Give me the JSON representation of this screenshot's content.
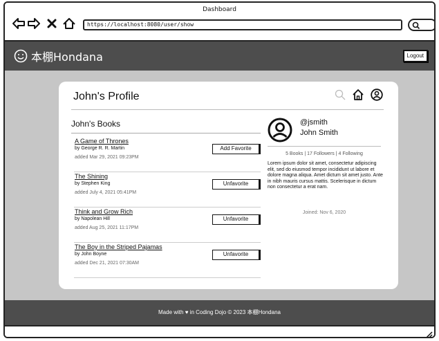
{
  "window": {
    "title": "Dashboard"
  },
  "browser": {
    "url": "https://localhost:8080/user/show",
    "icons": [
      "back-arrow-icon",
      "forward-arrow-icon",
      "close-x-icon",
      "home-icon",
      "search-icon"
    ]
  },
  "navbar": {
    "brand": "本棚Hondana",
    "logo_icon": "smiley-icon",
    "logout_label": "Logout"
  },
  "profile": {
    "title": "John's Profile",
    "icons": [
      "search-icon",
      "home-icon",
      "user-circle-icon"
    ]
  },
  "books": {
    "heading": "John's Books",
    "items": [
      {
        "title": "A Game of Thrones",
        "author": "by George R. R. Martin",
        "added": "added Mar 29, 2021 09:23PM",
        "action": "Add Favorite"
      },
      {
        "title": "The Shining",
        "author": "by Stephen King",
        "added": "added July 4, 2021 05:41PM",
        "action": "Unfavorite"
      },
      {
        "title": "Think and Grow Rich",
        "author": "by Napolean Hill",
        "added": "added Aug 25, 2021 11:17PM",
        "action": "Unfavorite"
      },
      {
        "title": "The Boy in the Striped Pajamas",
        "author": "by John Boyne",
        "added": "added Dec 21, 2021 07:30AM",
        "action": "Unfavorite"
      }
    ]
  },
  "user": {
    "handle": "@jsmith",
    "name": "John Smith",
    "stats": "5 Books | 17 Followers | 4 Following",
    "bio": "Lorem ipsum dolor sit amet, consectetur adipiscing elit, sed do eiusmod tempor incididunt ut labore et dolore magna aliqua. Amet dictum sit amet justo. Ante in nibh mauris cursus mattis. Scelerisque in dictum non consectetur a erat nam.",
    "joined": "Joined: Nov 6, 2020"
  },
  "footer": {
    "text": "Made with ♥ in Coding Dojo © 2023 本棚Hondana"
  }
}
